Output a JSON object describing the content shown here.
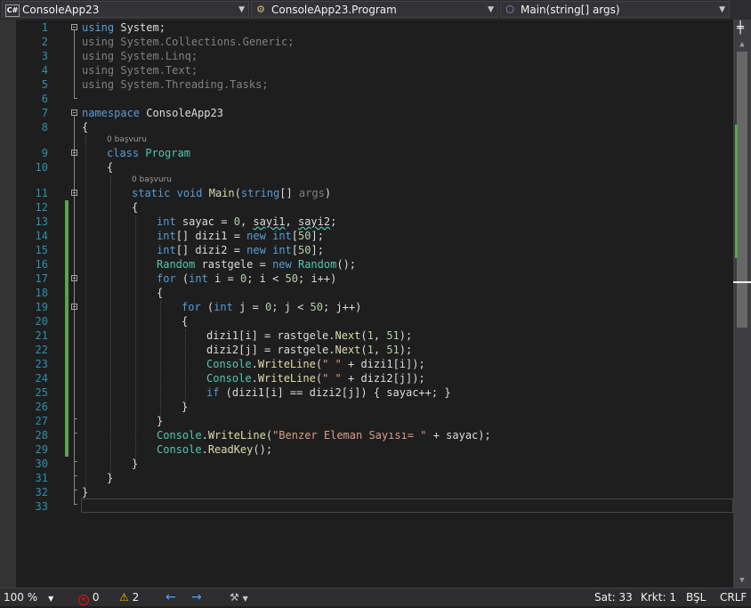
{
  "toolbar": {
    "project": {
      "icon": "C#",
      "label": "ConsoleApp23"
    },
    "class": {
      "label": "ConsoleApp23.Program"
    },
    "member": {
      "label": "Main(string[] args)"
    }
  },
  "codelens": {
    "class": "0 başvuru",
    "method": "0 başvuru"
  },
  "line_numbers": [
    "1",
    "2",
    "3",
    "4",
    "5",
    "6",
    "7",
    "8",
    "9",
    "10",
    "11",
    "12",
    "13",
    "14",
    "15",
    "16",
    "17",
    "18",
    "19",
    "20",
    "21",
    "22",
    "23",
    "24",
    "25",
    "26",
    "27",
    "28",
    "29",
    "30",
    "31",
    "32",
    "33"
  ],
  "code": {
    "l1": {
      "kw": "using",
      "ns": " System",
      "end": ";"
    },
    "l2": {
      "kw": "using",
      "ns": " System.Collections.Generic",
      "end": ";"
    },
    "l3": {
      "kw": "using",
      "ns": " System.Linq",
      "end": ";"
    },
    "l4": {
      "kw": "using",
      "ns": " System.Text",
      "end": ";"
    },
    "l5": {
      "kw": "using",
      "ns": " System.Threading.Tasks",
      "end": ";"
    },
    "l7": {
      "kw": "namespace",
      "ns": " ConsoleApp23"
    },
    "l8": "{",
    "l9": {
      "kw": "class",
      "name": "Program"
    },
    "l10": "{",
    "l11": {
      "kw1": "static",
      "kw2": "void",
      "name": "Main",
      "p1": "(",
      "kw3": "string",
      "p2": "[] ",
      "arg": "args",
      "p3": ")"
    },
    "l12": "{",
    "l13": {
      "kw": "int",
      "a": " sayac = ",
      "n": "0",
      "b": ", ",
      "c": "sayi1",
      "d": ", ",
      "e": "sayi2",
      "f": ";"
    },
    "l14": {
      "kw": "int",
      "a": "[] dizi1 = ",
      "kw2": "new",
      "sp": " ",
      "kw3": "int",
      "b": "[",
      "n": "50",
      "c": "];"
    },
    "l15": {
      "kw": "int",
      "a": "[] dizi2 = ",
      "kw2": "new",
      "sp": " ",
      "kw3": "int",
      "b": "[",
      "n": "50",
      "c": "];"
    },
    "l16": {
      "t": "Random",
      "a": " rastgele = ",
      "kw": "new",
      "sp": " ",
      "t2": "Random",
      "b": "();"
    },
    "l17": {
      "kw": "for",
      "a": " (",
      "kw2": "int",
      "b": " i = ",
      "n1": "0",
      "c": "; i < ",
      "n2": "50",
      "d": "; i++)"
    },
    "l18": "{",
    "l19": {
      "kw": "for",
      "a": " (",
      "kw2": "int",
      "b": " j = ",
      "n1": "0",
      "c": "; j < ",
      "n2": "50",
      "d": "; j++)"
    },
    "l20": "{",
    "l21": {
      "a": "dizi1[i] = rastgele.",
      "m": "Next",
      "b": "(",
      "n1": "1",
      "c": ", ",
      "n2": "51",
      "d": ");"
    },
    "l22": {
      "a": "dizi2[j] = rastgele.",
      "m": "Next",
      "b": "(",
      "n1": "1",
      "c": ", ",
      "n2": "51",
      "d": ");"
    },
    "l23": {
      "t": "Console",
      "a": ".",
      "m": "WriteLine",
      "b": "(",
      "s": "\" \"",
      "c": " + dizi1[i]);"
    },
    "l24": {
      "t": "Console",
      "a": ".",
      "m": "WriteLine",
      "b": "(",
      "s": "\" \"",
      "c": " + dizi2[j]);"
    },
    "l25": {
      "kw": "if",
      "a": " (dizi1[i] == dizi2[j]) { sayac++; }"
    },
    "l26": "}",
    "l27": "}",
    "l28": {
      "t": "Console",
      "a": ".",
      "m": "WriteLine",
      "b": "(",
      "s": "\"Benzer Eleman Sayısı= \"",
      "c": " + sayac);"
    },
    "l29": {
      "t": "Console",
      "a": ".",
      "m": "ReadKey",
      "b": "();"
    },
    "l30": "}",
    "l31": "}",
    "l32": "}"
  },
  "status": {
    "zoom": "100 %",
    "errors": "0",
    "warnings": "2",
    "line": "Sat: 33",
    "col": "Krkt: 1",
    "ins": "BŞL",
    "eol": "CRLF"
  }
}
